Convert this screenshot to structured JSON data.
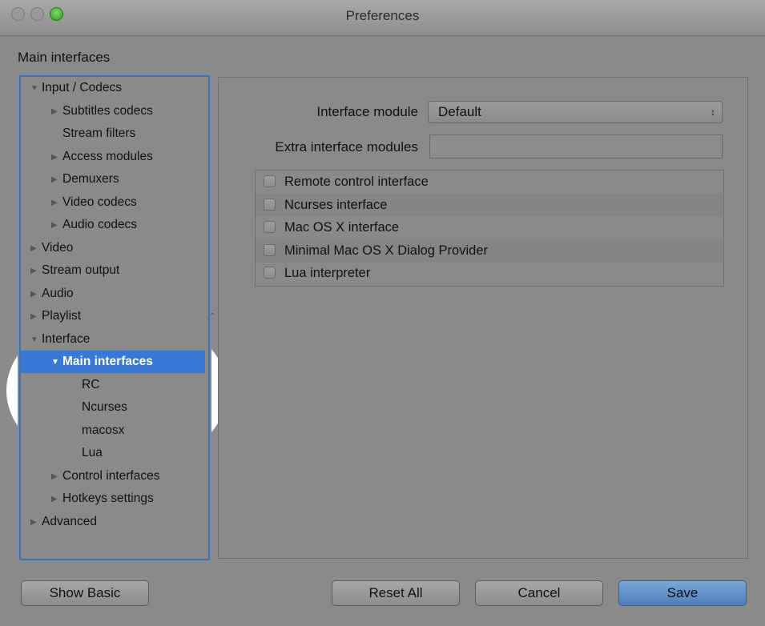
{
  "window": {
    "title": "Preferences"
  },
  "section_title": "Main interfaces",
  "tree": [
    {
      "label": "Input / Codecs",
      "expanded": true,
      "has_children": true,
      "indent": 0,
      "selected": false
    },
    {
      "label": "Subtitles codecs",
      "expanded": false,
      "has_children": true,
      "indent": 1,
      "selected": false
    },
    {
      "label": "Stream filters",
      "expanded": false,
      "has_children": false,
      "indent": 1,
      "selected": false
    },
    {
      "label": "Access modules",
      "expanded": false,
      "has_children": true,
      "indent": 1,
      "selected": false
    },
    {
      "label": "Demuxers",
      "expanded": false,
      "has_children": true,
      "indent": 1,
      "selected": false
    },
    {
      "label": "Video codecs",
      "expanded": false,
      "has_children": true,
      "indent": 1,
      "selected": false
    },
    {
      "label": "Audio codecs",
      "expanded": false,
      "has_children": true,
      "indent": 1,
      "selected": false
    },
    {
      "label": "Video",
      "expanded": false,
      "has_children": true,
      "indent": 0,
      "selected": false
    },
    {
      "label": "Stream output",
      "expanded": false,
      "has_children": true,
      "indent": 0,
      "selected": false
    },
    {
      "label": "Audio",
      "expanded": false,
      "has_children": true,
      "indent": 0,
      "selected": false
    },
    {
      "label": "Playlist",
      "expanded": false,
      "has_children": true,
      "indent": 0,
      "selected": false
    },
    {
      "label": "Interface",
      "expanded": true,
      "has_children": true,
      "indent": 0,
      "selected": false
    },
    {
      "label": "Main interfaces",
      "expanded": true,
      "has_children": true,
      "indent": 1,
      "selected": true
    },
    {
      "label": "RC",
      "expanded": false,
      "has_children": false,
      "indent": 2,
      "selected": false
    },
    {
      "label": "Ncurses",
      "expanded": false,
      "has_children": false,
      "indent": 2,
      "selected": false
    },
    {
      "label": "macosx",
      "expanded": false,
      "has_children": false,
      "indent": 2,
      "selected": false
    },
    {
      "label": "Lua",
      "expanded": false,
      "has_children": false,
      "indent": 2,
      "selected": false
    },
    {
      "label": "Control interfaces",
      "expanded": false,
      "has_children": true,
      "indent": 1,
      "selected": false
    },
    {
      "label": "Hotkeys settings",
      "expanded": false,
      "has_children": true,
      "indent": 1,
      "selected": false
    },
    {
      "label": "Advanced",
      "expanded": false,
      "has_children": true,
      "indent": 0,
      "selected": false
    }
  ],
  "form": {
    "interface_module_label": "Interface module",
    "interface_module_value": "Default",
    "extra_modules_label": "Extra interface modules",
    "extra_modules_value": ""
  },
  "checkboxes": [
    {
      "label": "Remote control interface",
      "checked": false
    },
    {
      "label": "Ncurses interface",
      "checked": false
    },
    {
      "label": "Mac OS X interface",
      "checked": false
    },
    {
      "label": "Minimal Mac OS X Dialog Provider",
      "checked": false
    },
    {
      "label": "Lua interpreter",
      "checked": false
    }
  ],
  "buttons": {
    "show_basic": "Show Basic",
    "reset_all": "Reset All",
    "cancel": "Cancel",
    "save": "Save"
  },
  "colors": {
    "selection": "#3a78d6",
    "window_bg": "#8a8a8a",
    "primary_button": "#4f7fb8"
  }
}
